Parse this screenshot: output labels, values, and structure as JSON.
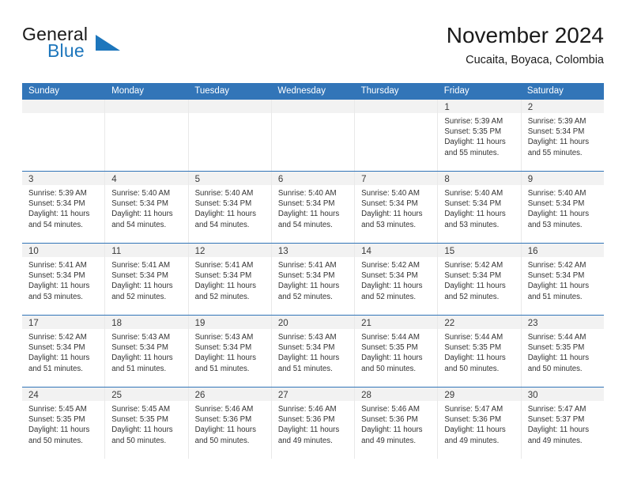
{
  "brand": {
    "name_part1": "General",
    "name_part2": "Blue",
    "accent_color": "#1d76bc"
  },
  "header": {
    "title": "November 2024",
    "location": "Cucaita, Boyaca, Colombia"
  },
  "calendar": {
    "header_bg": "#3275b8",
    "weekdays": [
      "Sunday",
      "Monday",
      "Tuesday",
      "Wednesday",
      "Thursday",
      "Friday",
      "Saturday"
    ],
    "weeks": [
      [
        {
          "day": "",
          "empty": true
        },
        {
          "day": "",
          "empty": true
        },
        {
          "day": "",
          "empty": true
        },
        {
          "day": "",
          "empty": true
        },
        {
          "day": "",
          "empty": true
        },
        {
          "day": "1",
          "sunrise": "Sunrise: 5:39 AM",
          "sunset": "Sunset: 5:35 PM",
          "daylight": "Daylight: 11 hours and 55 minutes."
        },
        {
          "day": "2",
          "sunrise": "Sunrise: 5:39 AM",
          "sunset": "Sunset: 5:34 PM",
          "daylight": "Daylight: 11 hours and 55 minutes."
        }
      ],
      [
        {
          "day": "3",
          "sunrise": "Sunrise: 5:39 AM",
          "sunset": "Sunset: 5:34 PM",
          "daylight": "Daylight: 11 hours and 54 minutes."
        },
        {
          "day": "4",
          "sunrise": "Sunrise: 5:40 AM",
          "sunset": "Sunset: 5:34 PM",
          "daylight": "Daylight: 11 hours and 54 minutes."
        },
        {
          "day": "5",
          "sunrise": "Sunrise: 5:40 AM",
          "sunset": "Sunset: 5:34 PM",
          "daylight": "Daylight: 11 hours and 54 minutes."
        },
        {
          "day": "6",
          "sunrise": "Sunrise: 5:40 AM",
          "sunset": "Sunset: 5:34 PM",
          "daylight": "Daylight: 11 hours and 54 minutes."
        },
        {
          "day": "7",
          "sunrise": "Sunrise: 5:40 AM",
          "sunset": "Sunset: 5:34 PM",
          "daylight": "Daylight: 11 hours and 53 minutes."
        },
        {
          "day": "8",
          "sunrise": "Sunrise: 5:40 AM",
          "sunset": "Sunset: 5:34 PM",
          "daylight": "Daylight: 11 hours and 53 minutes."
        },
        {
          "day": "9",
          "sunrise": "Sunrise: 5:40 AM",
          "sunset": "Sunset: 5:34 PM",
          "daylight": "Daylight: 11 hours and 53 minutes."
        }
      ],
      [
        {
          "day": "10",
          "sunrise": "Sunrise: 5:41 AM",
          "sunset": "Sunset: 5:34 PM",
          "daylight": "Daylight: 11 hours and 53 minutes."
        },
        {
          "day": "11",
          "sunrise": "Sunrise: 5:41 AM",
          "sunset": "Sunset: 5:34 PM",
          "daylight": "Daylight: 11 hours and 52 minutes."
        },
        {
          "day": "12",
          "sunrise": "Sunrise: 5:41 AM",
          "sunset": "Sunset: 5:34 PM",
          "daylight": "Daylight: 11 hours and 52 minutes."
        },
        {
          "day": "13",
          "sunrise": "Sunrise: 5:41 AM",
          "sunset": "Sunset: 5:34 PM",
          "daylight": "Daylight: 11 hours and 52 minutes."
        },
        {
          "day": "14",
          "sunrise": "Sunrise: 5:42 AM",
          "sunset": "Sunset: 5:34 PM",
          "daylight": "Daylight: 11 hours and 52 minutes."
        },
        {
          "day": "15",
          "sunrise": "Sunrise: 5:42 AM",
          "sunset": "Sunset: 5:34 PM",
          "daylight": "Daylight: 11 hours and 52 minutes."
        },
        {
          "day": "16",
          "sunrise": "Sunrise: 5:42 AM",
          "sunset": "Sunset: 5:34 PM",
          "daylight": "Daylight: 11 hours and 51 minutes."
        }
      ],
      [
        {
          "day": "17",
          "sunrise": "Sunrise: 5:42 AM",
          "sunset": "Sunset: 5:34 PM",
          "daylight": "Daylight: 11 hours and 51 minutes."
        },
        {
          "day": "18",
          "sunrise": "Sunrise: 5:43 AM",
          "sunset": "Sunset: 5:34 PM",
          "daylight": "Daylight: 11 hours and 51 minutes."
        },
        {
          "day": "19",
          "sunrise": "Sunrise: 5:43 AM",
          "sunset": "Sunset: 5:34 PM",
          "daylight": "Daylight: 11 hours and 51 minutes."
        },
        {
          "day": "20",
          "sunrise": "Sunrise: 5:43 AM",
          "sunset": "Sunset: 5:34 PM",
          "daylight": "Daylight: 11 hours and 51 minutes."
        },
        {
          "day": "21",
          "sunrise": "Sunrise: 5:44 AM",
          "sunset": "Sunset: 5:35 PM",
          "daylight": "Daylight: 11 hours and 50 minutes."
        },
        {
          "day": "22",
          "sunrise": "Sunrise: 5:44 AM",
          "sunset": "Sunset: 5:35 PM",
          "daylight": "Daylight: 11 hours and 50 minutes."
        },
        {
          "day": "23",
          "sunrise": "Sunrise: 5:44 AM",
          "sunset": "Sunset: 5:35 PM",
          "daylight": "Daylight: 11 hours and 50 minutes."
        }
      ],
      [
        {
          "day": "24",
          "sunrise": "Sunrise: 5:45 AM",
          "sunset": "Sunset: 5:35 PM",
          "daylight": "Daylight: 11 hours and 50 minutes."
        },
        {
          "day": "25",
          "sunrise": "Sunrise: 5:45 AM",
          "sunset": "Sunset: 5:35 PM",
          "daylight": "Daylight: 11 hours and 50 minutes."
        },
        {
          "day": "26",
          "sunrise": "Sunrise: 5:46 AM",
          "sunset": "Sunset: 5:36 PM",
          "daylight": "Daylight: 11 hours and 50 minutes."
        },
        {
          "day": "27",
          "sunrise": "Sunrise: 5:46 AM",
          "sunset": "Sunset: 5:36 PM",
          "daylight": "Daylight: 11 hours and 49 minutes."
        },
        {
          "day": "28",
          "sunrise": "Sunrise: 5:46 AM",
          "sunset": "Sunset: 5:36 PM",
          "daylight": "Daylight: 11 hours and 49 minutes."
        },
        {
          "day": "29",
          "sunrise": "Sunrise: 5:47 AM",
          "sunset": "Sunset: 5:36 PM",
          "daylight": "Daylight: 11 hours and 49 minutes."
        },
        {
          "day": "30",
          "sunrise": "Sunrise: 5:47 AM",
          "sunset": "Sunset: 5:37 PM",
          "daylight": "Daylight: 11 hours and 49 minutes."
        }
      ]
    ]
  }
}
